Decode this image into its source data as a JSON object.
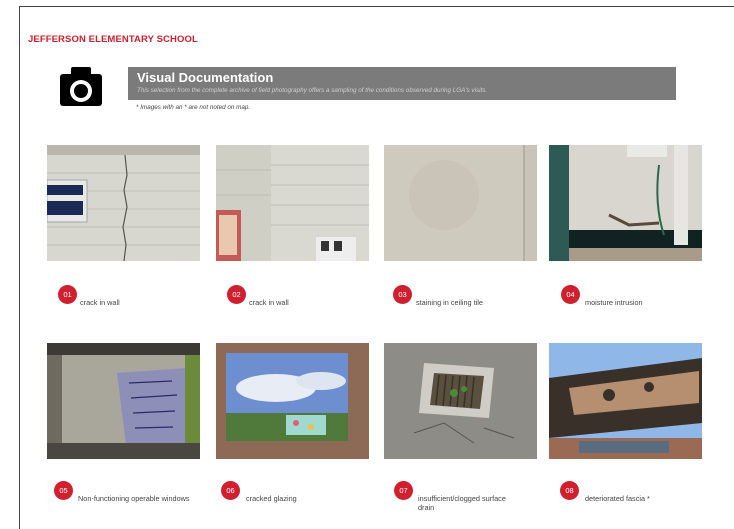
{
  "school_name": "JEFFERSON ELEMENTARY SCHOOL",
  "section": {
    "title": "Visual Documentation",
    "subtitle": "This selection from the complete archive of field photography offers a sampling of the conditions observed during LGA's visits.",
    "note": "* Images with an * are not noted on map."
  },
  "icon": "camera-icon",
  "accent_color": "#d0202f",
  "photos": [
    {
      "number": "01",
      "caption": "crack in wall"
    },
    {
      "number": "02",
      "caption": "crack in wall"
    },
    {
      "number": "03",
      "caption": "staining in ceiling tile"
    },
    {
      "number": "04",
      "caption": "moisture intrusion"
    },
    {
      "number": "05",
      "caption": "Non-functioning operable windows"
    },
    {
      "number": "06",
      "caption": "cracked glazing"
    },
    {
      "number": "07",
      "caption": "insufficient/clogged surface drain"
    },
    {
      "number": "08",
      "caption": "deteriorated fascia *"
    }
  ]
}
